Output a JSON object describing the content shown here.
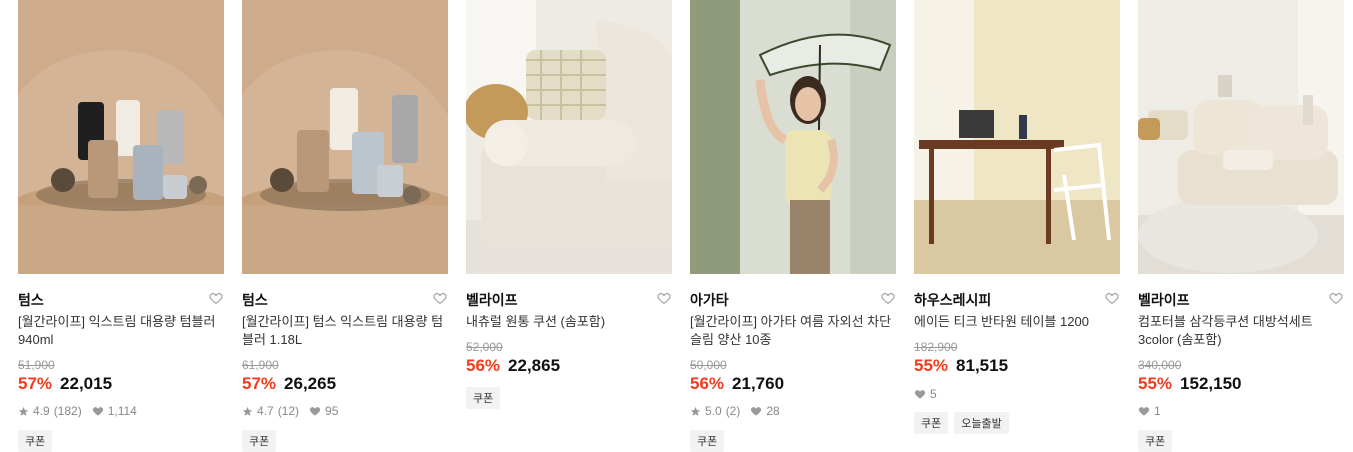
{
  "products": [
    {
      "brand": "텀스",
      "title": "[월간라이프] 익스트림 대용량 텀블러 940ml",
      "original_price": "51,900",
      "discount": "57%",
      "price": "22,015",
      "rating": "4.9",
      "reviews": "(182)",
      "likes": "1,114",
      "tags": [
        "쿠폰"
      ],
      "image_icon": "tumbler-product-photo"
    },
    {
      "brand": "텀스",
      "title": "[월간라이프] 텀스 익스트림 대용량 텀블러 1.18L",
      "original_price": "61,900",
      "discount": "57%",
      "price": "26,265",
      "rating": "4.7",
      "reviews": "(12)",
      "likes": "95",
      "tags": [
        "쿠폰"
      ],
      "image_icon": "tumbler-product-photo"
    },
    {
      "brand": "벨라이프",
      "title": "내츄럴 원통 쿠션 (솜포함)",
      "original_price": "52,000",
      "discount": "56%",
      "price": "22,865",
      "tags": [
        "쿠폰"
      ],
      "image_icon": "cushion-sofa-photo"
    },
    {
      "brand": "아가타",
      "title": "[월간라이프] 아가타 여름 자외선 차단 슬림 양산 10종",
      "original_price": "50,000",
      "discount": "56%",
      "price": "21,760",
      "rating": "5.0",
      "reviews": "(2)",
      "likes": "28",
      "tags": [
        "쿠폰"
      ],
      "image_icon": "parasol-model-photo"
    },
    {
      "brand": "하우스레시피",
      "title": "에이든 티크 반타원 테이블 1200",
      "original_price": "182,900",
      "discount": "55%",
      "price": "81,515",
      "likes": "5",
      "tags": [
        "쿠폰",
        "오늘출발"
      ],
      "image_icon": "desk-chair-photo"
    },
    {
      "brand": "벨라이프",
      "title": "컴포터블 삼각등쿠션 대방석세트 3color (솜포함)",
      "original_price": "340,000",
      "discount": "55%",
      "price": "152,150",
      "likes": "1",
      "tags": [
        "쿠폰"
      ],
      "image_icon": "floor-cushion-photo"
    }
  ],
  "colors": {
    "discount": "#f23c1d",
    "strike": "#999999",
    "tag_bg": "#f2f2f2"
  }
}
